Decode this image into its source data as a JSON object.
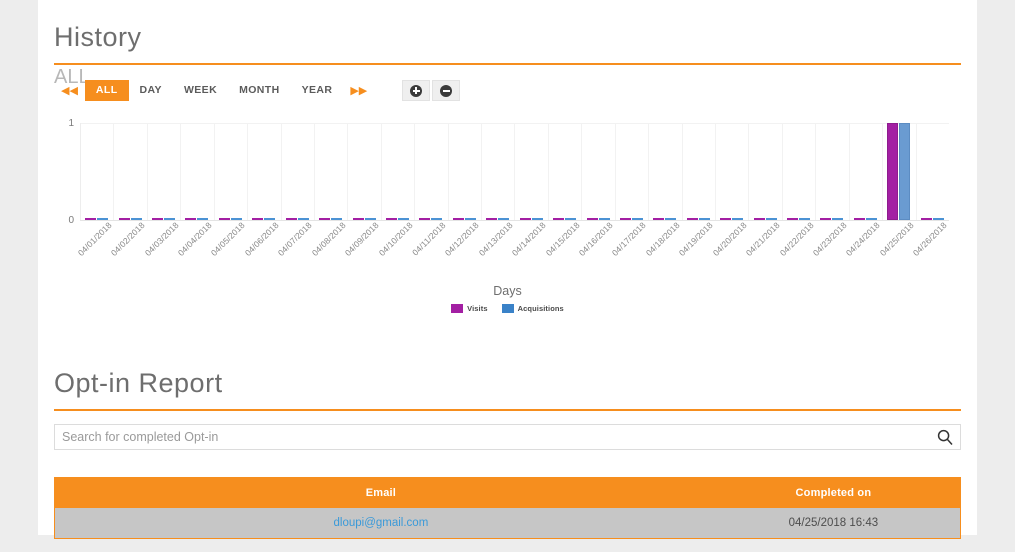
{
  "history": {
    "title": "History",
    "period_caption": "ALL",
    "prev_label": "◀◀",
    "next_label": "▶▶",
    "periods": [
      {
        "label": "ALL",
        "active": true
      },
      {
        "label": "DAY",
        "active": false
      },
      {
        "label": "WEEK",
        "active": false
      },
      {
        "label": "MONTH",
        "active": false
      },
      {
        "label": "YEAR",
        "active": false
      }
    ],
    "zoom_in_icon": "zoom-in-icon",
    "zoom_out_icon": "zoom-out-icon",
    "accent_color": "#f68e1e"
  },
  "chart_data": {
    "type": "bar",
    "title": "",
    "xlabel": "Days",
    "ylabel": "",
    "ylim": [
      0,
      1
    ],
    "yticks": [
      "0",
      "1"
    ],
    "grid": true,
    "legend_position": "bottom",
    "categories": [
      "04/01/2018",
      "04/02/2018",
      "04/03/2018",
      "04/04/2018",
      "04/05/2018",
      "04/06/2018",
      "04/07/2018",
      "04/08/2018",
      "04/09/2018",
      "04/10/2018",
      "04/11/2018",
      "04/12/2018",
      "04/13/2018",
      "04/14/2018",
      "04/15/2018",
      "04/16/2018",
      "04/17/2018",
      "04/18/2018",
      "04/19/2018",
      "04/20/2018",
      "04/21/2018",
      "04/22/2018",
      "04/23/2018",
      "04/24/2018",
      "04/25/2018",
      "04/26/2018"
    ],
    "series": [
      {
        "name": "Visits",
        "color": "#a31fa3",
        "values": [
          0,
          0,
          0,
          0,
          0,
          0,
          0,
          0,
          0,
          0,
          0,
          0,
          0,
          0,
          0,
          0,
          0,
          0,
          0,
          0,
          0,
          0,
          0,
          0,
          1,
          0
        ]
      },
      {
        "name": "Acquisitions",
        "color": "#6a9bd1",
        "values": [
          0,
          0,
          0,
          0,
          0,
          0,
          0,
          0,
          0,
          0,
          0,
          0,
          0,
          0,
          0,
          0,
          0,
          0,
          0,
          0,
          0,
          0,
          0,
          0,
          1,
          0
        ]
      }
    ]
  },
  "optin": {
    "title": "Opt-in Report",
    "search_placeholder": "Search for completed Opt-in",
    "search_value": "",
    "search_icon": "search-icon",
    "table": {
      "columns": [
        "Email",
        "Completed on"
      ],
      "rows": [
        {
          "email": "dloupi@gmail.com",
          "completed_on": "04/25/2018 16:43"
        }
      ]
    }
  }
}
